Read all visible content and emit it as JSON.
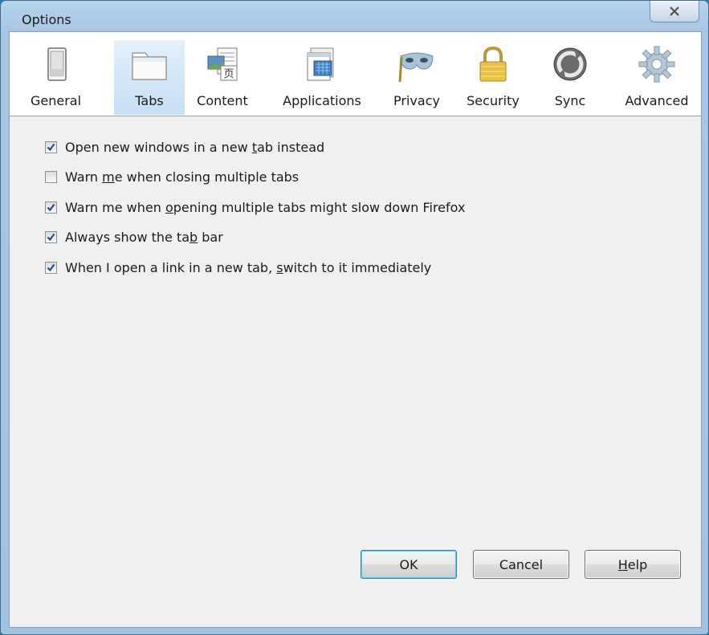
{
  "window": {
    "title": "Options"
  },
  "toolbar": {
    "panes": [
      {
        "label": "General",
        "icon": "general-switch-icon",
        "selected": false
      },
      {
        "label": "Tabs",
        "icon": "tabs-folder-icon",
        "selected": true
      },
      {
        "label": "Content",
        "icon": "content-page-icon",
        "selected": false
      },
      {
        "label": "Applications",
        "icon": "applications-window-icon",
        "selected": false
      },
      {
        "label": "Privacy",
        "icon": "privacy-mask-icon",
        "selected": false
      },
      {
        "label": "Security",
        "icon": "security-padlock-icon",
        "selected": false
      },
      {
        "label": "Sync",
        "icon": "sync-arrows-icon",
        "selected": false
      },
      {
        "label": "Advanced",
        "icon": "advanced-gear-icon",
        "selected": false
      }
    ]
  },
  "options": [
    {
      "pre": "Open new windows in a new ",
      "key": "t",
      "post": "ab instead",
      "checked": true
    },
    {
      "pre": "Warn ",
      "key": "m",
      "post": "e when closing multiple tabs",
      "checked": false
    },
    {
      "pre": "Warn me when ",
      "key": "o",
      "post": "pening multiple tabs might slow down Firefox",
      "checked": true
    },
    {
      "pre": "Always show the ta",
      "key": "b",
      "post": " bar",
      "checked": true
    },
    {
      "pre": "When I open a link in a new tab, ",
      "key": "s",
      "post": "witch to it immediately",
      "checked": true
    }
  ],
  "buttons": {
    "ok": "OK",
    "cancel": "Cancel",
    "help_key": "H",
    "help_rest": "elp"
  },
  "colors": {
    "desktop": "#1a7fb5",
    "window_frame": "#a7c6e3",
    "dialog_bg": "#f0f0f0",
    "selected_pane": "#c5dff5"
  }
}
